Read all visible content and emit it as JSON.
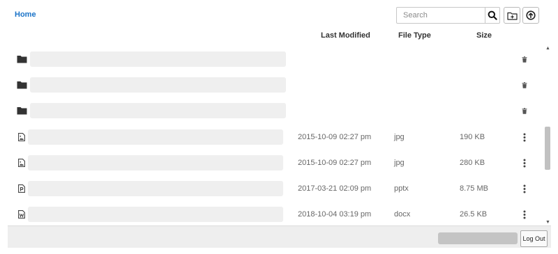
{
  "breadcrumb": {
    "home": "Home"
  },
  "toolbar": {
    "search_placeholder": "Search",
    "search_icon": "search-icon",
    "new_folder_icon": "new-folder-icon",
    "upload_icon": "upload-icon"
  },
  "columns": {
    "modified": "Last Modified",
    "type": "File Type",
    "size": "Size"
  },
  "rows": [
    {
      "kind": "folder",
      "name": "",
      "modified": "",
      "type": "",
      "size": "",
      "action_icon": "trash-icon"
    },
    {
      "kind": "folder",
      "name": "",
      "modified": "",
      "type": "",
      "size": "",
      "action_icon": "trash-icon"
    },
    {
      "kind": "folder",
      "name": "",
      "modified": "",
      "type": "",
      "size": "",
      "action_icon": "trash-icon"
    },
    {
      "kind": "image",
      "name": "",
      "modified": "2015-10-09 02:27 pm",
      "type": "jpg",
      "size": "190 KB",
      "action_icon": "more-vertical-icon"
    },
    {
      "kind": "image",
      "name": "",
      "modified": "2015-10-09 02:27 pm",
      "type": "jpg",
      "size": "280 KB",
      "action_icon": "more-vertical-icon"
    },
    {
      "kind": "presentation",
      "name": "",
      "modified": "2017-03-21 02:09 pm",
      "type": "pptx",
      "size": "8.75 MB",
      "action_icon": "more-vertical-icon"
    },
    {
      "kind": "document",
      "name": "",
      "modified": "2018-10-04 03:19 pm",
      "type": "docx",
      "size": "26.5 KB",
      "action_icon": "more-vertical-icon"
    }
  ],
  "footer": {
    "logout_label": "Log Out"
  },
  "colors": {
    "link": "#1a73c8",
    "name_placeholder": "#efefef",
    "footer_bg": "#eeeeee"
  }
}
